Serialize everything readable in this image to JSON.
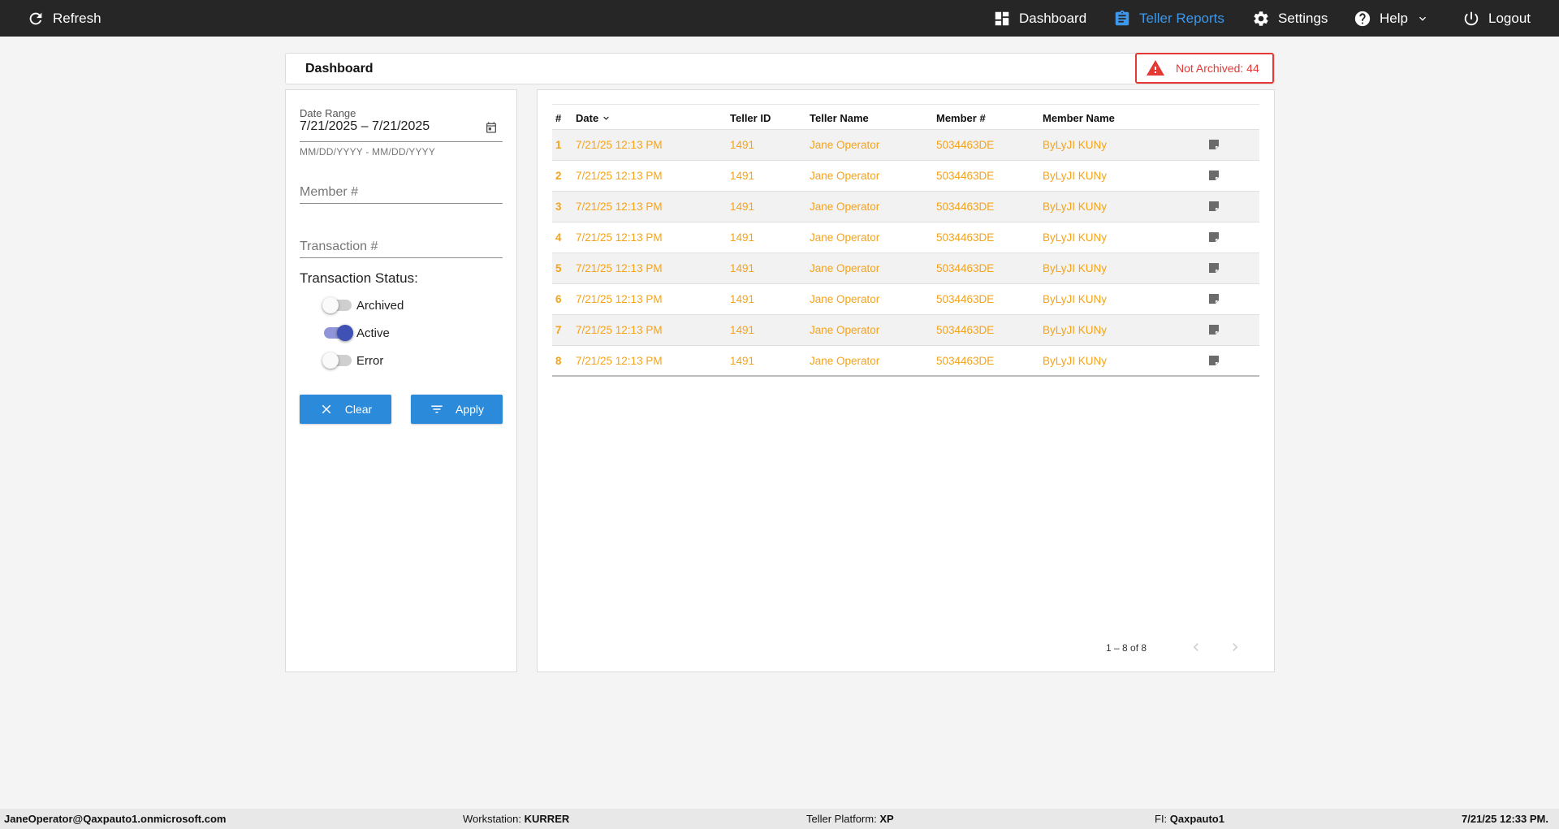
{
  "topbar": {
    "refresh_label": "Refresh",
    "nav": [
      {
        "label": "Dashboard"
      },
      {
        "label": "Teller Reports",
        "active": true
      },
      {
        "label": "Settings"
      },
      {
        "label": "Help"
      },
      {
        "label": "Logout"
      }
    ],
    "accent_color": "#3d97ea"
  },
  "header": {
    "title": "Dashboard",
    "alert_text": "Not Archived: 44",
    "alert_color": "#e53935"
  },
  "filters": {
    "date_range_label": "Date Range",
    "date_range_value": "7/21/2025 – 7/21/2025",
    "date_hint": "MM/DD/YYYY - MM/DD/YYYY",
    "member_placeholder": "Member #",
    "transaction_placeholder": "Transaction #",
    "status_label": "Transaction Status:",
    "toggles": [
      {
        "label": "Archived",
        "on": false
      },
      {
        "label": "Active",
        "on": true
      },
      {
        "label": "Error",
        "on": false
      }
    ],
    "clear_label": "Clear",
    "apply_label": "Apply"
  },
  "table": {
    "columns": [
      "#",
      "Date",
      "Teller ID",
      "Teller Name",
      "Member #",
      "Member Name"
    ],
    "sort_column": "Date",
    "rows": [
      {
        "num": "1",
        "date": "7/21/25 12:13 PM",
        "teller_id": "1491",
        "teller_name": "Jane Operator",
        "member_no": "5034463DE",
        "member_name": "ByLyJI KUNy"
      },
      {
        "num": "2",
        "date": "7/21/25 12:13 PM",
        "teller_id": "1491",
        "teller_name": "Jane Operator",
        "member_no": "5034463DE",
        "member_name": "ByLyJI KUNy"
      },
      {
        "num": "3",
        "date": "7/21/25 12:13 PM",
        "teller_id": "1491",
        "teller_name": "Jane Operator",
        "member_no": "5034463DE",
        "member_name": "ByLyJI KUNy"
      },
      {
        "num": "4",
        "date": "7/21/25 12:13 PM",
        "teller_id": "1491",
        "teller_name": "Jane Operator",
        "member_no": "5034463DE",
        "member_name": "ByLyJI KUNy"
      },
      {
        "num": "5",
        "date": "7/21/25 12:13 PM",
        "teller_id": "1491",
        "teller_name": "Jane Operator",
        "member_no": "5034463DE",
        "member_name": "ByLyJI KUNy"
      },
      {
        "num": "6",
        "date": "7/21/25 12:13 PM",
        "teller_id": "1491",
        "teller_name": "Jane Operator",
        "member_no": "5034463DE",
        "member_name": "ByLyJI KUNy"
      },
      {
        "num": "7",
        "date": "7/21/25 12:13 PM",
        "teller_id": "1491",
        "teller_name": "Jane Operator",
        "member_no": "5034463DE",
        "member_name": "ByLyJI KUNy"
      },
      {
        "num": "8",
        "date": "7/21/25 12:13 PM",
        "teller_id": "1491",
        "teller_name": "Jane Operator",
        "member_no": "5034463DE",
        "member_name": "ByLyJI KUNy"
      }
    ],
    "row_text_color": "#f5a319",
    "paginator_range": "1 – 8 of 8"
  },
  "footer": {
    "user": "JaneOperator@Qaxpauto1.onmicrosoft.com",
    "workstation_label": "Workstation:",
    "workstation_value": "KURRER",
    "platform_label": "Teller Platform:",
    "platform_value": "XP",
    "fi_label": "FI:",
    "fi_value": "Qaxpauto1",
    "datetime": "7/21/25 12:33 PM."
  }
}
